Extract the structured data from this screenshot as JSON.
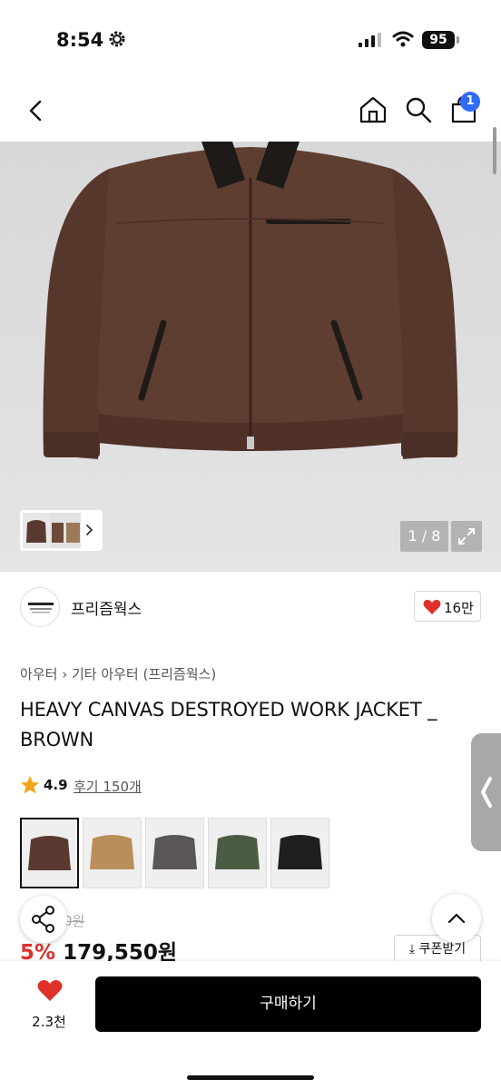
{
  "status_bar": {
    "time": "8:54",
    "battery": "95"
  },
  "nav": {
    "cart_count": "1"
  },
  "gallery": {
    "counter": "1 / 8"
  },
  "store": {
    "name": "프리즘웍스",
    "logo_text": "PRIZMWORKS",
    "like_count": "16만"
  },
  "breadcrumb": {
    "category": "아우터",
    "sub": "기타 아우터 (프리즘웍스)"
  },
  "product": {
    "title": "HEAVY CANVAS DESTROYED WORK JACKET _ BROWN",
    "rating": "4.9",
    "reviews": "후기 150개",
    "original_price": "0원",
    "discount": "5%",
    "price": "179,550원",
    "coupon": "쿠폰받기"
  },
  "colors": [
    {
      "name": "brown",
      "hex": "#5a3a30"
    },
    {
      "name": "beige",
      "hex": "#b98e5a"
    },
    {
      "name": "charcoal",
      "hex": "#5a5558"
    },
    {
      "name": "olive",
      "hex": "#4b5c45"
    },
    {
      "name": "black",
      "hex": "#1f1f1f"
    }
  ],
  "bottom_bar": {
    "wish_count": "2.3천",
    "buy_label": "구매하기"
  },
  "accent": {
    "red": "#e0302a",
    "blue": "#2f6bff"
  }
}
